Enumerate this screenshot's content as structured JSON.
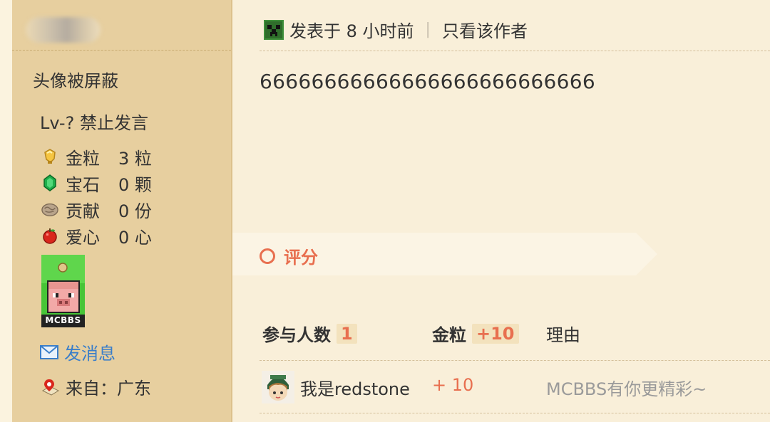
{
  "sidebar": {
    "avatar_notice": "头像被屏蔽",
    "level": "Lv-? 禁止发言",
    "stats": [
      {
        "icon": "gold-nugget-icon",
        "label": "金粒",
        "value": "3 粒"
      },
      {
        "icon": "emerald-icon",
        "label": "宝石",
        "value": "0 颗"
      },
      {
        "icon": "contribution-icon",
        "label": "贡献",
        "value": "0 份"
      },
      {
        "icon": "apple-heart-icon",
        "label": "爱心",
        "value": "0 心"
      }
    ],
    "medal_text": "MCBBS",
    "send_message": "发消息",
    "location": "来自：广东"
  },
  "post": {
    "posted_time": "发表于 8 小时前",
    "only_author": "只看该作者",
    "content": "66666666666666666666666666"
  },
  "rating": {
    "title": "评分",
    "participants_label": "参与人数",
    "participants_count": "1",
    "gold_label": "金粒",
    "gold_total": "+10",
    "reason_label": "理由",
    "entries": [
      {
        "user": "我是redstone",
        "amount": "+ 10",
        "reason": "MCBBS有你更精彩~"
      }
    ]
  },
  "colors": {
    "accent": "#e86f4f",
    "sidebar_bg": "#e7cf9f",
    "main_bg": "#f9efd9",
    "link": "#3a7ec9"
  }
}
